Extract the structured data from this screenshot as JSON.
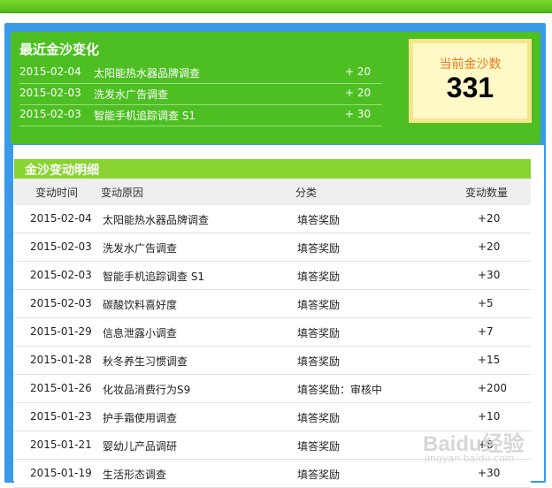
{
  "recent": {
    "title": "最近金沙变化",
    "rows": [
      {
        "date": "2015-02-04",
        "reason": "太阳能热水器品牌调查",
        "amount": "+ 20"
      },
      {
        "date": "2015-02-03",
        "reason": "洗发水广告调查",
        "amount": "+ 20"
      },
      {
        "date": "2015-02-03",
        "reason": "智能手机追踪调查 S1",
        "amount": "+ 30"
      }
    ]
  },
  "balance": {
    "label": "当前金沙数",
    "value": "331"
  },
  "detail": {
    "title": "金沙变动明细",
    "columns": [
      "变动时间",
      "变动原因",
      "分类",
      "变动数量"
    ],
    "rows": [
      {
        "date": "2015-02-04",
        "reason": "太阳能热水器品牌调查",
        "type": "填答奖励",
        "amount": "+20"
      },
      {
        "date": "2015-02-03",
        "reason": "洗发水广告调查",
        "type": "填答奖励",
        "amount": "+20"
      },
      {
        "date": "2015-02-03",
        "reason": "智能手机追踪调查 S1",
        "type": "填答奖励",
        "amount": "+30"
      },
      {
        "date": "2015-02-03",
        "reason": "碳酸饮料喜好度",
        "type": "填答奖励",
        "amount": "+5"
      },
      {
        "date": "2015-01-29",
        "reason": "信息泄露小调查",
        "type": "填答奖励",
        "amount": "+7"
      },
      {
        "date": "2015-01-28",
        "reason": "秋冬养生习惯调查",
        "type": "填答奖励",
        "amount": "+15"
      },
      {
        "date": "2015-01-26",
        "reason": "化妆品消费行为S9",
        "type": "填答奖励：审核中",
        "amount": "+200"
      },
      {
        "date": "2015-01-23",
        "reason": "护手霜使用调查",
        "type": "填答奖励",
        "amount": "+10"
      },
      {
        "date": "2015-01-21",
        "reason": "婴幼儿产品调研",
        "type": "填答奖励",
        "amount": "+8"
      },
      {
        "date": "2015-01-19",
        "reason": "生活形态调查",
        "type": "填答奖励",
        "amount": "+30"
      }
    ]
  },
  "watermark": {
    "main": "Baidu经验",
    "sub": "jingyan.baidu.com"
  },
  "colors": {
    "panel_green": "#4dbf22",
    "header_green": "#8ad432",
    "frame_blue": "#3b9ae8",
    "balance_label": "#e8791b"
  }
}
